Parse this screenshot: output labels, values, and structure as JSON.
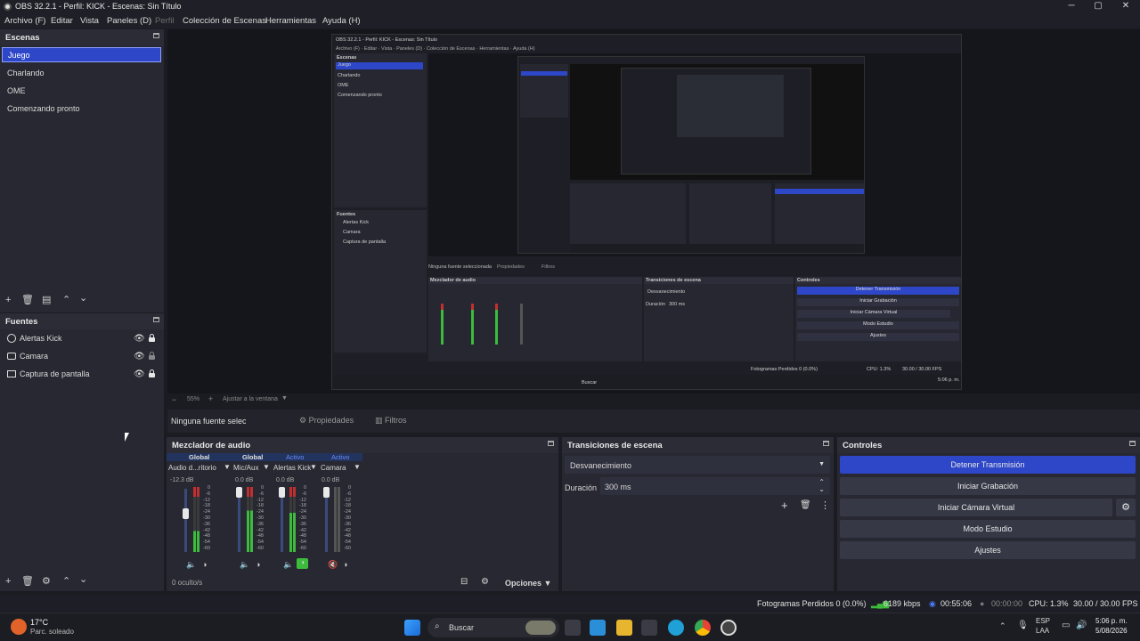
{
  "window": {
    "title": "OBS 32.2.1 - Perfil: KICK - Escenas: Sin Título"
  },
  "menu": {
    "items": [
      "Archivo (F)",
      "Editar",
      "Vista",
      "Paneles (D)",
      "Perfil",
      "Colección de Escenas",
      "Herramientas",
      "Ayuda (H)"
    ]
  },
  "scenes": {
    "title": "Escenas",
    "items": [
      "Juego",
      "Charlando",
      "OME",
      "Comenzando pronto"
    ],
    "selected": "Juego"
  },
  "sources": {
    "title": "Fuentes",
    "items": [
      {
        "label": "Alertas Kick",
        "icon": "browser-icon"
      },
      {
        "label": "Camara",
        "icon": "camera-icon"
      },
      {
        "label": "Captura de pantalla",
        "icon": "monitor-icon"
      }
    ]
  },
  "zoom": {
    "value": "55%",
    "fit_label": "Ajustar a la ventana"
  },
  "source_toolbar": {
    "no_selection": "Ninguna fuente seleccionada",
    "properties": "Propiedades",
    "filters": "Filtros"
  },
  "mixer": {
    "title": "Mezclador de audio",
    "channels": [
      {
        "tag": "Global",
        "name": "Audio d...ritorio",
        "db": "-12.3 dB",
        "level": 0.4
      },
      {
        "tag": "Global",
        "name": "Mic/Aux",
        "db": "0.0 dB",
        "level": 0.8
      },
      {
        "tag": "Activo",
        "name": "Alertas Kick",
        "db": "0.0 dB",
        "level": 0.75
      },
      {
        "tag": "Activo",
        "name": "Camara",
        "db": "0.0 dB",
        "level": 0.0
      }
    ],
    "scale": [
      "0",
      "-6",
      "-12",
      "-18",
      "-24",
      "-30",
      "-36",
      "-42",
      "-48",
      "-54",
      "-60"
    ],
    "hidden": "0 oculto/s",
    "options": "Opciones"
  },
  "transitions": {
    "title": "Transiciones de escena",
    "selected": "Desvanecimiento",
    "duration_label": "Duración",
    "duration_value": "300 ms"
  },
  "controls": {
    "title": "Controles",
    "stop_stream": "Detener Transmisión",
    "start_recording": "Iniciar Grabación",
    "start_virtual_cam": "Iniciar Cámara Virtual",
    "studio_mode": "Modo Estudio",
    "settings": "Ajustes"
  },
  "status": {
    "dropped_frames": "Fotogramas Perdidos 0 (0.0%)",
    "bitrate": "6189 kbps",
    "stream_time": "00:55:06",
    "rec_time": "00:00:00",
    "cpu": "CPU: 1.3%",
    "fps": "30.00 / 30.00 FPS"
  },
  "taskbar": {
    "weather_temp": "17°C",
    "weather_desc": "Parc. soleado",
    "search": "Buscar",
    "lang": "ESP",
    "lang2": "LAA",
    "time": "5:06 p. m.",
    "date": "5/08/2026"
  },
  "colors": {
    "accent": "#2d47c8",
    "meter_green": "#3dbb3d",
    "meter_red": "#c03030",
    "panel": "#272831"
  }
}
